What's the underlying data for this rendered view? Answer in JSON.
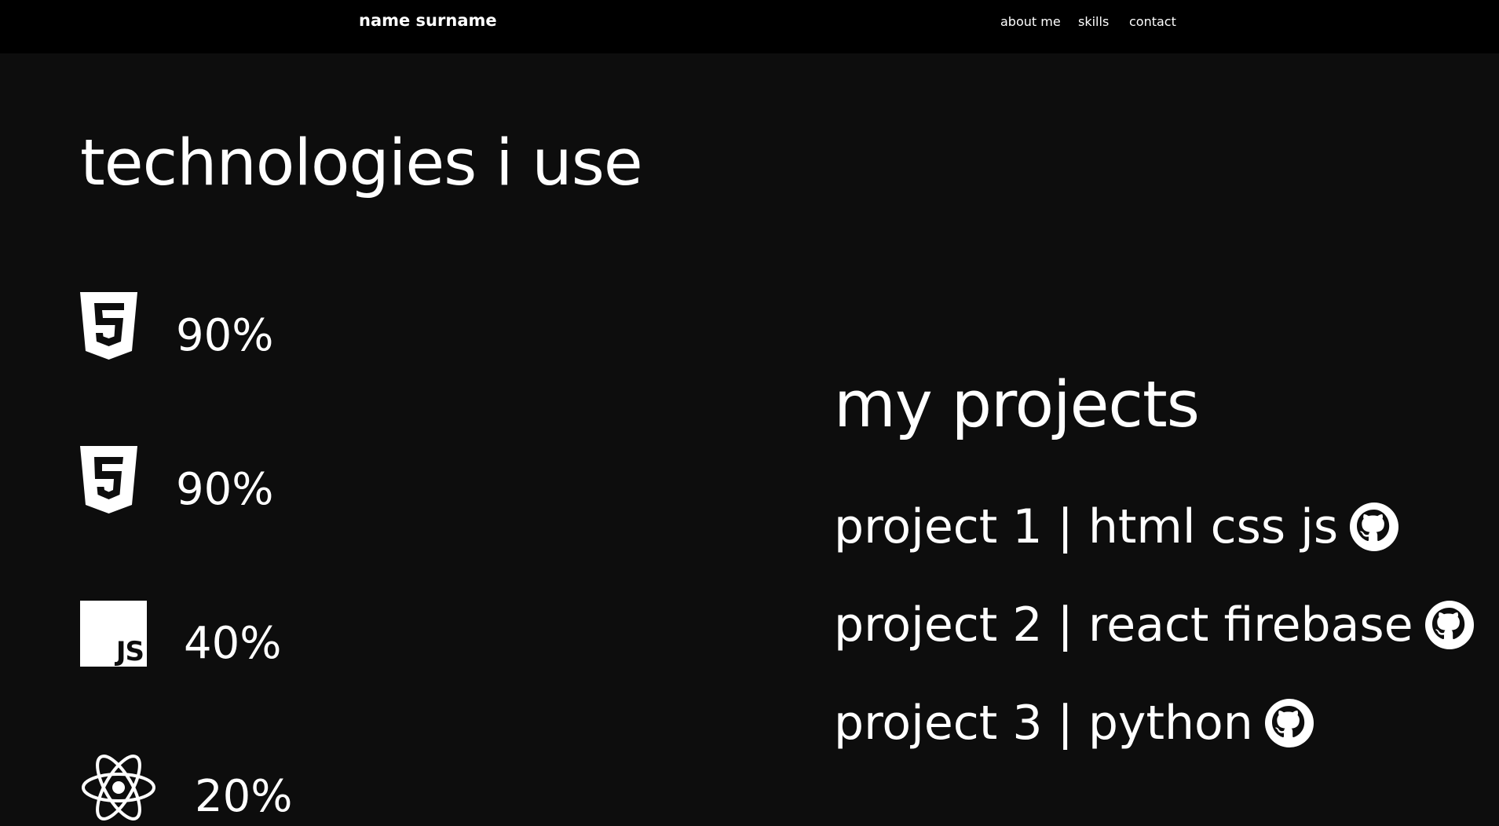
{
  "header": {
    "brand": "name surname",
    "nav": [
      "about me",
      "skills",
      "contact"
    ]
  },
  "technologies": {
    "title": "technologies i use",
    "items": [
      {
        "icon": "html5-icon",
        "percent": "90%"
      },
      {
        "icon": "css3-icon",
        "percent": "90%"
      },
      {
        "icon": "javascript-icon",
        "percent": "40%",
        "badge": "JS"
      },
      {
        "icon": "react-icon",
        "percent": "20%"
      }
    ]
  },
  "projects": {
    "title": "my projects",
    "items": [
      {
        "label": "project 1 | html css js",
        "icon": "github-icon"
      },
      {
        "label": "project 2 | react firebase",
        "icon": "github-icon"
      },
      {
        "label": "project 3 | python",
        "icon": "github-icon"
      }
    ]
  },
  "colors": {
    "background": "#0d0d0d",
    "header": "#000000",
    "text": "#ffffff"
  }
}
